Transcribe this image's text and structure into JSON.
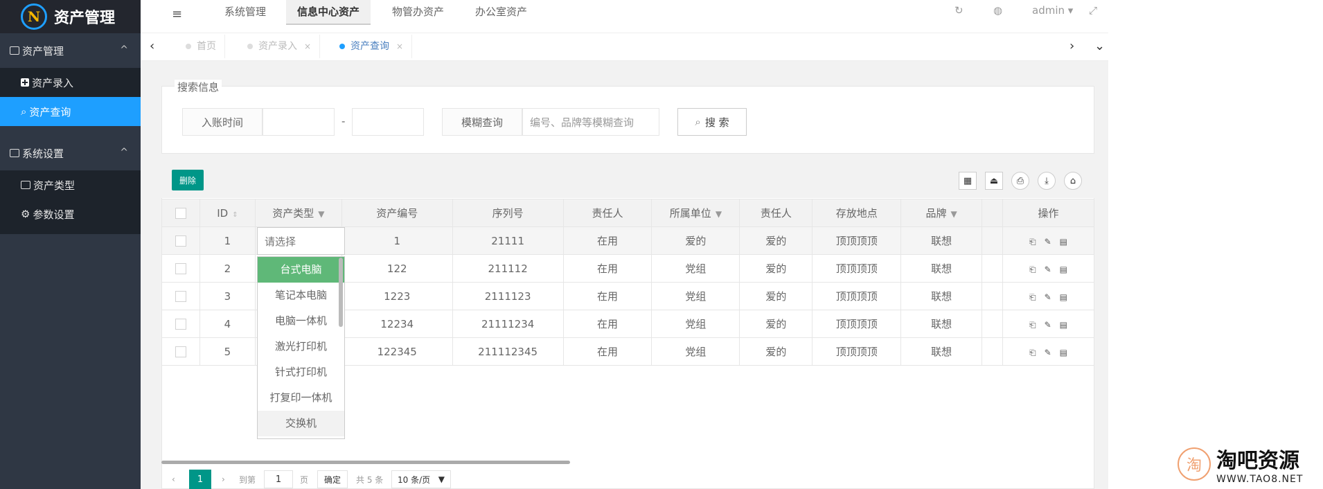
{
  "app": {
    "logo_letters": "N",
    "title": "资产管理"
  },
  "sidebar": {
    "groups": [
      {
        "label": "资产管理",
        "chevron": "^"
      },
      {
        "label": "系统设置",
        "chevron": "^"
      }
    ],
    "items": [
      {
        "label": "资产录入"
      },
      {
        "label": "资产查询"
      },
      {
        "label": "资产类型"
      },
      {
        "label": "参数设置"
      }
    ]
  },
  "topbar": {
    "toggle_icon": "≡",
    "tabs": [
      "系统管理",
      "信息中心资产",
      "物管办资产",
      "办公室资产"
    ],
    "refresh_icon": "↻",
    "theme_icon": "◍",
    "user": "admin ▾",
    "fullscreen_icon": "⤢"
  },
  "page_tabs": {
    "prev_icon": "‹",
    "next_icon": "›",
    "more_icon": "⌄",
    "tabs": [
      {
        "label": "首页"
      },
      {
        "label": "资产录入",
        "close": "×"
      },
      {
        "label": "资产查询",
        "close": "×"
      }
    ]
  },
  "search": {
    "legend": "搜索信息",
    "date_label": "入账时间",
    "date_sep": "-",
    "fuzzy_label": "模糊查询",
    "fuzzy_placeholder": "编号、品牌等模糊查询",
    "button_icon": "⌕",
    "button_label": "搜 索"
  },
  "toolbar": {
    "delete_label": "删除",
    "icons": [
      "▦",
      "⏏",
      "⎙",
      "⤓",
      "⌂"
    ]
  },
  "table": {
    "columns": [
      "ID",
      "资产类型",
      "资产编号",
      "序列号",
      "责任人",
      "所属单位",
      "责任人",
      "存放地点",
      "品牌",
      "操作"
    ],
    "col_status_label": "责任人",
    "col_unit_label": "所属单位",
    "rows": [
      {
        "id": "1",
        "type": "",
        "code": "1",
        "serial": "21111",
        "status": "在用",
        "unit": "爱的",
        "owner": "爱的",
        "location": "顶顶顶顶",
        "brand": "联想"
      },
      {
        "id": "2",
        "type": "",
        "code": "122",
        "serial": "211112",
        "status": "在用",
        "unit": "党组",
        "owner": "爱的",
        "location": "顶顶顶顶",
        "brand": "联想"
      },
      {
        "id": "3",
        "type": "",
        "code": "1223",
        "serial": "2111123",
        "status": "在用",
        "unit": "党组",
        "owner": "爱的",
        "location": "顶顶顶顶",
        "brand": "联想"
      },
      {
        "id": "4",
        "type": "",
        "code": "12234",
        "serial": "21111234",
        "status": "在用",
        "unit": "党组",
        "owner": "爱的",
        "location": "顶顶顶顶",
        "brand": "联想"
      },
      {
        "id": "5",
        "type": "",
        "code": "122345",
        "serial": "211112345",
        "status": "在用",
        "unit": "党组",
        "owner": "爱的",
        "location": "顶顶顶顶",
        "brand": "联想"
      }
    ],
    "op_icons": [
      "⎗",
      "✎",
      "▤"
    ]
  },
  "dropdown": {
    "placeholder": "请选择",
    "options": [
      "台式电脑",
      "笔记本电脑",
      "电脑一体机",
      "激光打印机",
      "针式打印机",
      "打复印一体机",
      "交换机"
    ]
  },
  "pager": {
    "prev": "‹",
    "current": "1",
    "next": "›",
    "goto_label": "到第",
    "goto_value": "1",
    "page_unit": "页",
    "confirm": "确定",
    "total": "共 5 条",
    "per_page": "10 条/页",
    "per_page_arrow": "▼"
  },
  "watermark": {
    "brand": "淘吧资源",
    "url": "WWW.TAO8.NET",
    "seal_char": "淘"
  }
}
